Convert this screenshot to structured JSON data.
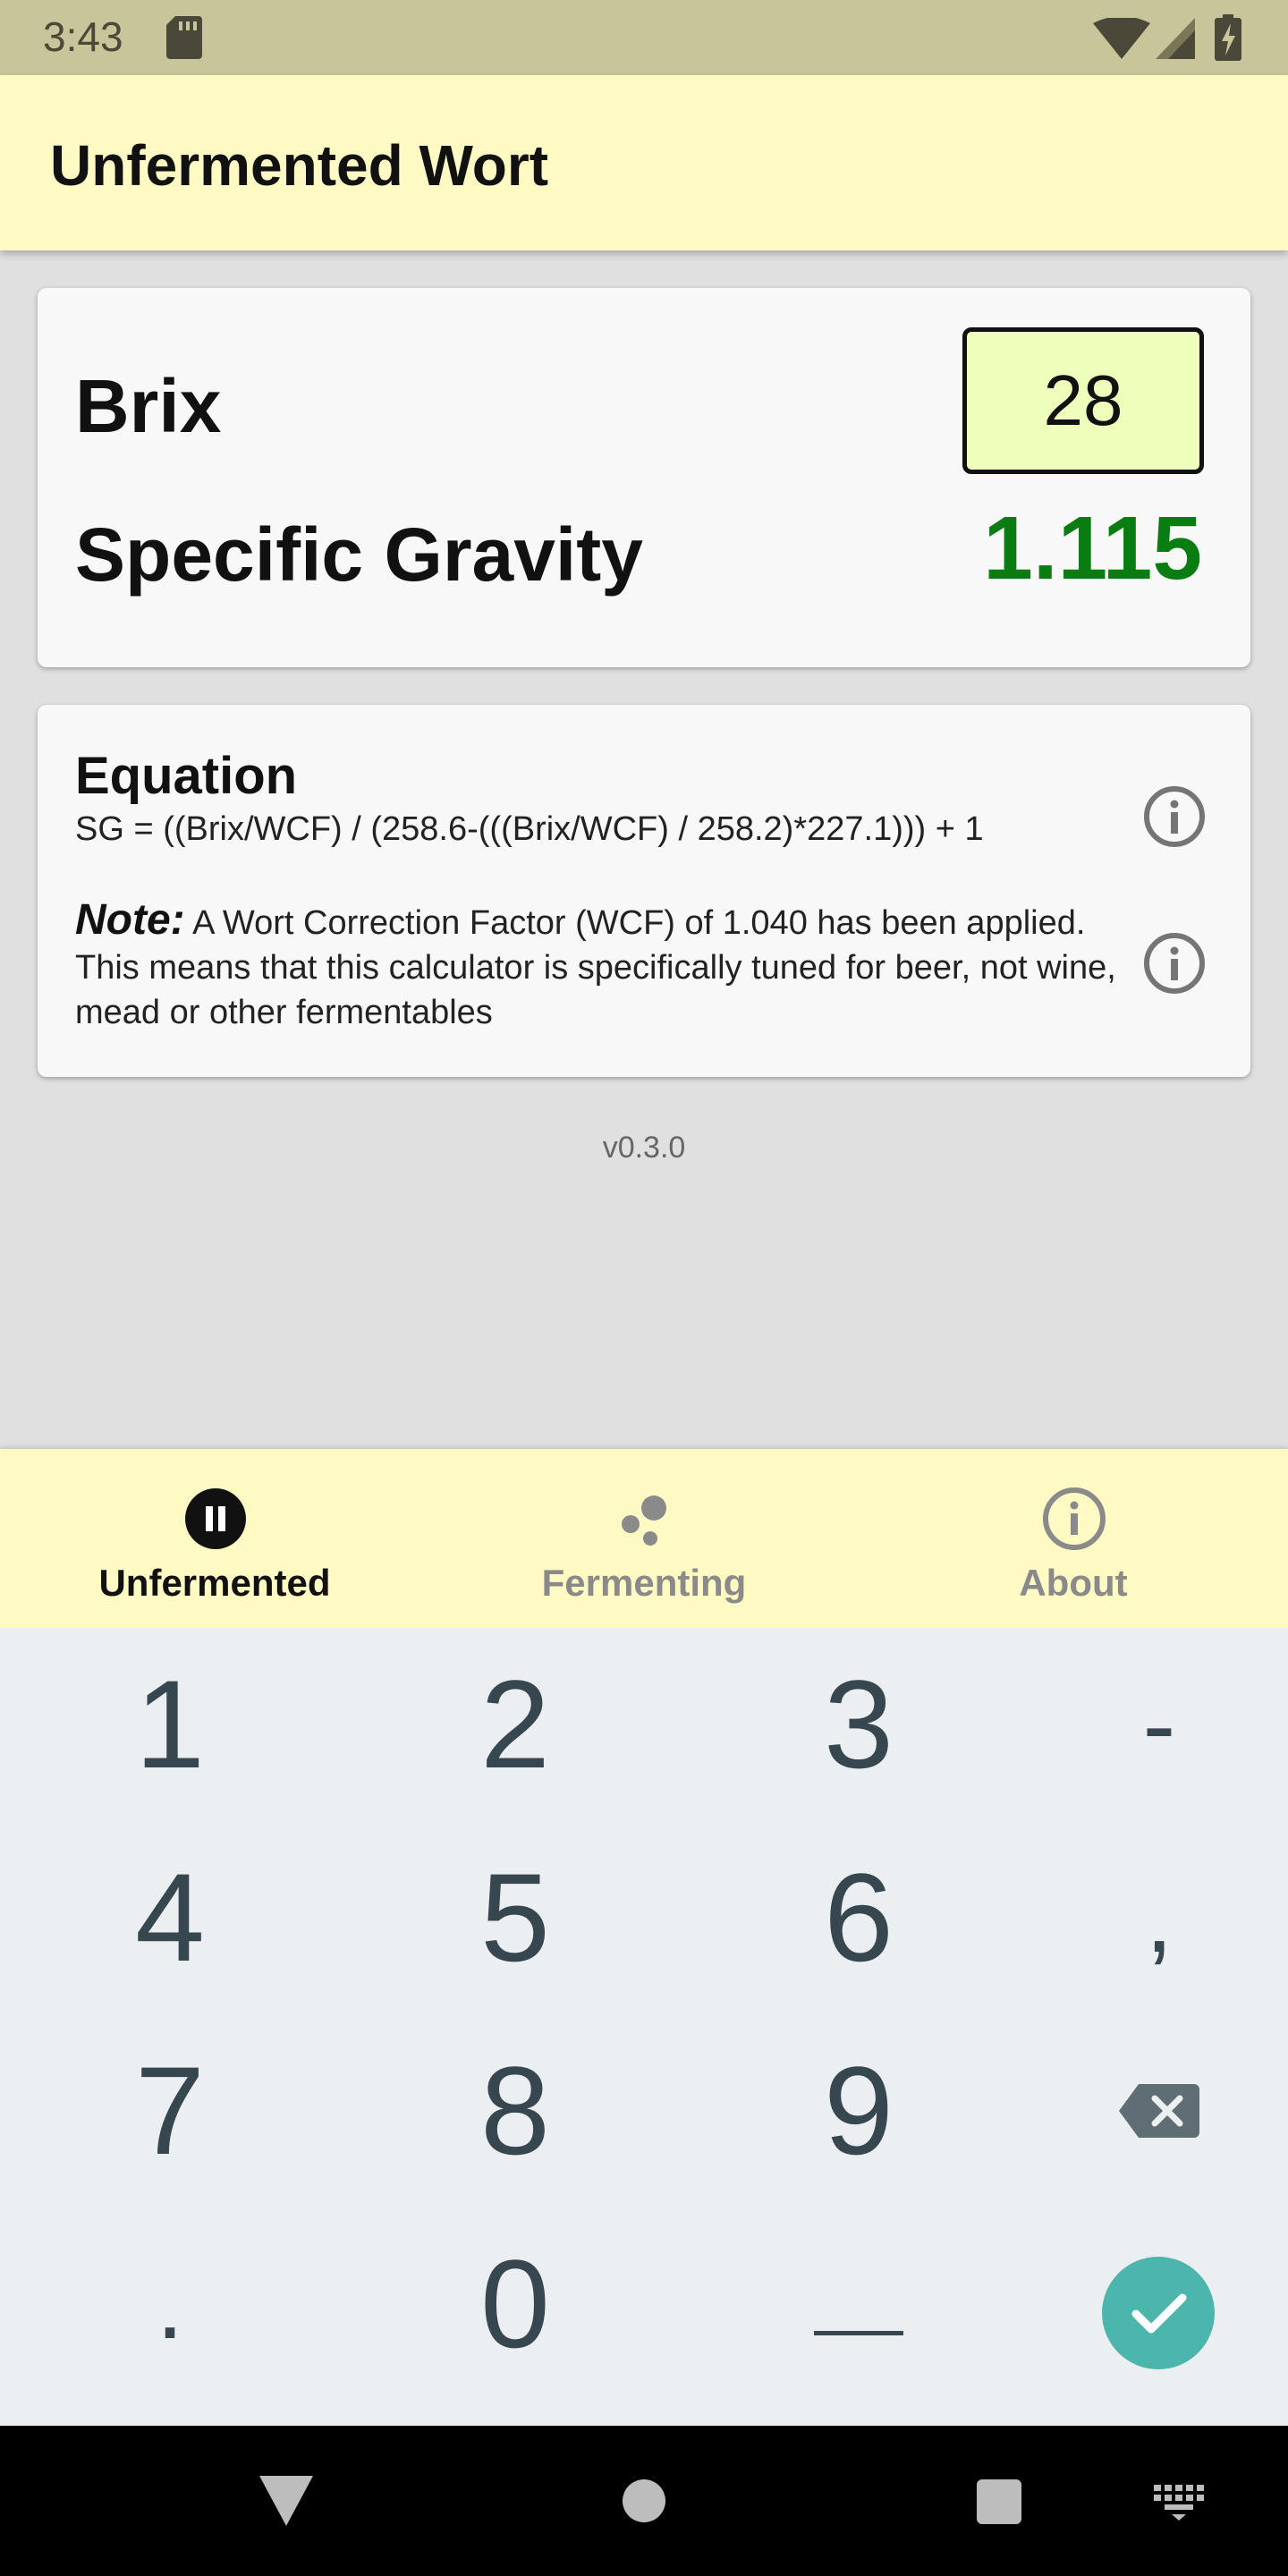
{
  "status_bar": {
    "time": "3:43"
  },
  "app_bar": {
    "title": "Unfermented Wort"
  },
  "conversion": {
    "brix_label": "Brix",
    "brix_value": "28",
    "sg_label": "Specific Gravity",
    "sg_value": "1.115",
    "sg_color": "#0a7d12"
  },
  "equation": {
    "title": "Equation",
    "formula": "SG = ((Brix/WCF) / (258.6-(((Brix/WCF) / 258.2)*227.1))) + 1",
    "note_label": "Note:",
    "note_text": "A Wort Correction Factor (WCF) of 1.040 has been applied. This means that this calculator is specifically tuned for beer, not wine, mead or other fermentables"
  },
  "version": "v0.3.0",
  "bottom_nav": {
    "items": [
      {
        "label": "Unfermented",
        "icon": "pause-circle-icon",
        "active": true
      },
      {
        "label": "Fermenting",
        "icon": "bubbles-icon",
        "active": false
      },
      {
        "label": "About",
        "icon": "info-icon",
        "active": false
      }
    ]
  },
  "keyboard": {
    "keys": [
      "1",
      "2",
      "3",
      "-",
      "4",
      "5",
      "6",
      ",",
      "7",
      "8",
      "9",
      "backspace",
      ".",
      "0",
      "space",
      "done"
    ]
  },
  "colors": {
    "app_bar": "#fff9c4",
    "status_bar": "#c9c59b",
    "input_bg": "#eeffbb",
    "done_key": "#4db6ac"
  }
}
